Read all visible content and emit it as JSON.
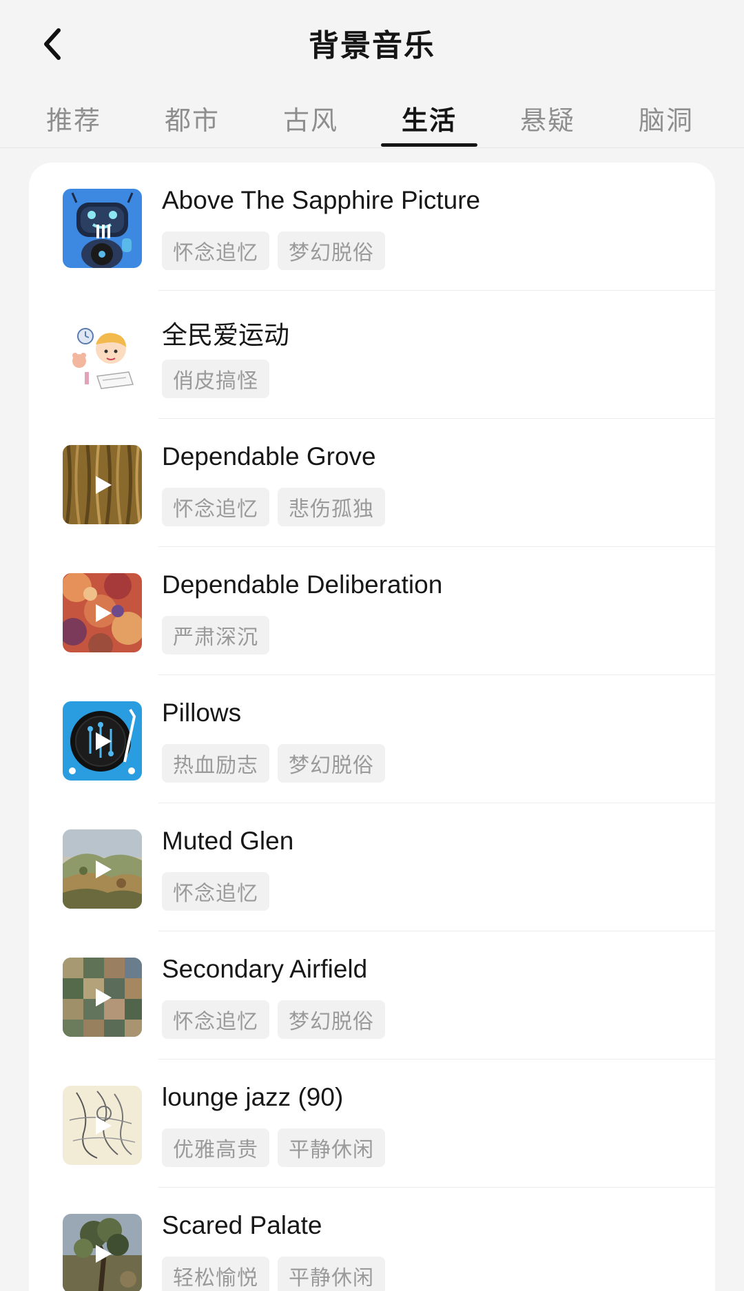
{
  "header": {
    "title": "背景音乐"
  },
  "tabs": [
    {
      "label": "推荐"
    },
    {
      "label": "都市"
    },
    {
      "label": "古风"
    },
    {
      "label": "生活",
      "active": true
    },
    {
      "label": "悬疑"
    },
    {
      "label": "脑洞"
    }
  ],
  "tracks": [
    {
      "title": "Above The Sapphire Picture",
      "tags": [
        "怀念追忆",
        "梦幻脱俗"
      ],
      "cover": "robot-icon"
    },
    {
      "title": "全民爱运动",
      "tags": [
        "俏皮搞怪"
      ],
      "cover": "cartoon-boy-icon"
    },
    {
      "title": "Dependable Grove",
      "tags": [
        "怀念追忆",
        "悲伤孤独"
      ],
      "cover": "wood-texture",
      "play": true
    },
    {
      "title": "Dependable Deliberation",
      "tags": [
        "严肃深沉"
      ],
      "cover": "abstract-painting",
      "play": true
    },
    {
      "title": "Pillows",
      "tags": [
        "热血励志",
        "梦幻脱俗"
      ],
      "cover": "turntable-icon",
      "play": true
    },
    {
      "title": "Muted Glen",
      "tags": [
        "怀念追忆"
      ],
      "cover": "landscape-painting",
      "play": true
    },
    {
      "title": "Secondary Airfield",
      "tags": [
        "怀念追忆",
        "梦幻脱俗"
      ],
      "cover": "mosaic-painting",
      "play": true
    },
    {
      "title": "lounge jazz (90)",
      "tags": [
        "优雅高贵",
        "平静休闲"
      ],
      "cover": "sketch-art",
      "play": true
    },
    {
      "title": "Scared Palate",
      "tags": [
        "轻松愉悦",
        "平静休闲"
      ],
      "cover": "tree-painting",
      "play": true
    }
  ]
}
